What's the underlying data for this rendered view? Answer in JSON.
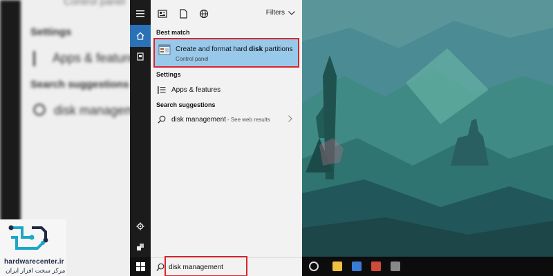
{
  "background": {
    "blur_control_panel": "Control panel",
    "blur_settings": "Settings",
    "blur_apps": "Apps & features",
    "blur_search_suggestions": "Search suggestions",
    "blur_disk": "disk management"
  },
  "watermark": {
    "name": "hardwarecenter.ir",
    "tagline": "مرکز سخت افزار ایران",
    "accent": "#1aa7c9"
  },
  "rail": {
    "icons": [
      "hamburger-icon",
      "home-icon",
      "documents-icon",
      "settings-icon",
      "user-icon",
      "windows-icon"
    ],
    "active_color": "#2b71b8"
  },
  "menu": {
    "top_icons": [
      "apps-tab-icon",
      "documents-tab-icon",
      "web-tab-icon"
    ],
    "filters_label": "Filters",
    "best_match_heading": "Best match",
    "best_match": {
      "title_prefix": "Create and format hard ",
      "title_bold": "disk",
      "title_suffix": " partitions",
      "subtitle": "Control panel",
      "icon": "control-panel-icon",
      "highlight": "#99c9ea"
    },
    "settings_heading": "Settings",
    "settings_item": "Apps & features",
    "suggestions_heading": "Search suggestions",
    "suggestion": {
      "text": "disk management",
      "hint": "- See web results"
    }
  },
  "search": {
    "value": "disk management",
    "highlight_color": "#d9262b"
  }
}
